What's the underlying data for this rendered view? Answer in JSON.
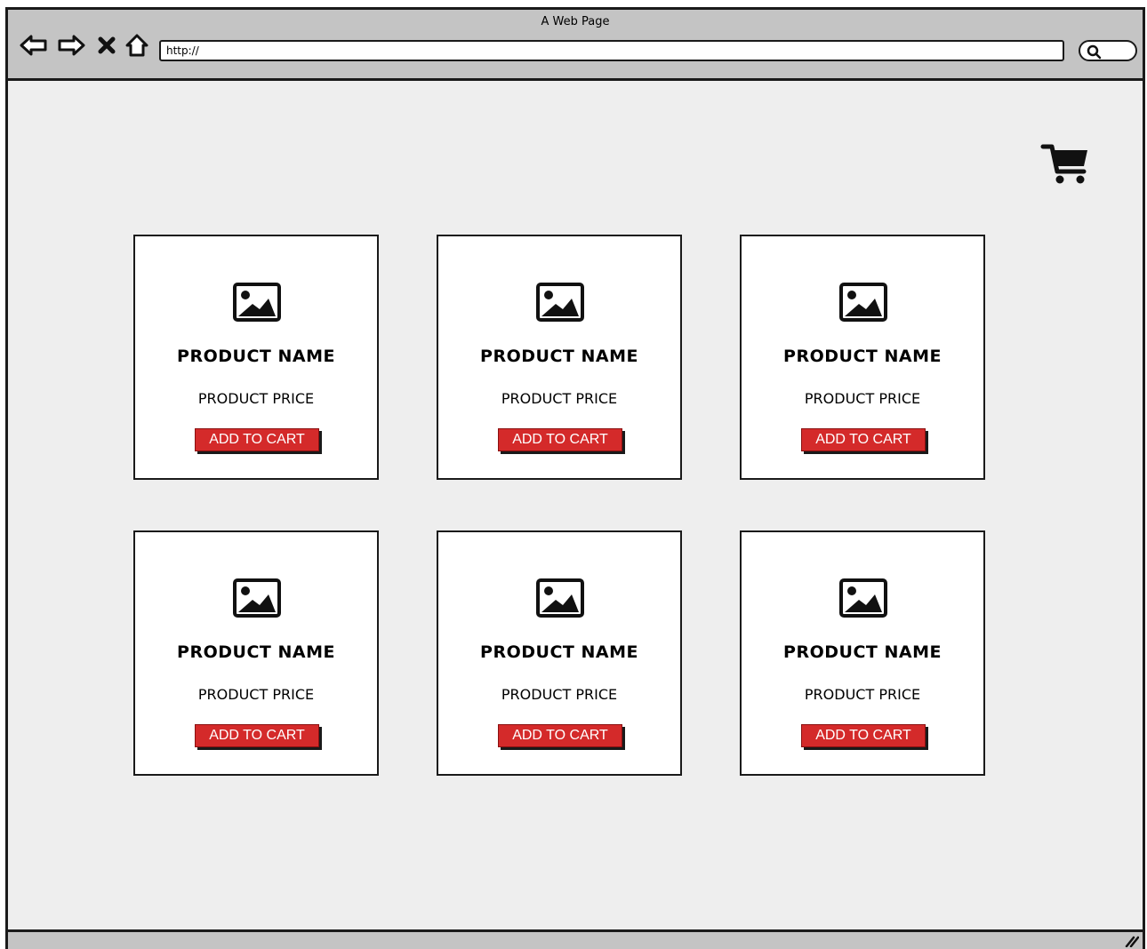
{
  "window": {
    "title": "A Web Page"
  },
  "toolbar": {
    "url": "http://",
    "icons": [
      "back-arrow-icon",
      "forward-arrow-icon",
      "close-icon",
      "home-icon",
      "search-icon"
    ]
  },
  "header": {
    "cart_icon": "shopping-cart-icon"
  },
  "products": [
    {
      "name": "PRODUCT NAME",
      "price": "PRODUCT PRICE",
      "button": "ADD TO CART",
      "image_icon": "image-placeholder-icon"
    },
    {
      "name": "PRODUCT NAME",
      "price": "PRODUCT PRICE",
      "button": "ADD TO CART",
      "image_icon": "image-placeholder-icon"
    },
    {
      "name": "PRODUCT NAME",
      "price": "PRODUCT PRICE",
      "button": "ADD TO CART",
      "image_icon": "image-placeholder-icon"
    },
    {
      "name": "PRODUCT NAME",
      "price": "PRODUCT PRICE",
      "button": "ADD TO CART",
      "image_icon": "image-placeholder-icon"
    },
    {
      "name": "PRODUCT NAME",
      "price": "PRODUCT PRICE",
      "button": "ADD TO CART",
      "image_icon": "image-placeholder-icon"
    },
    {
      "name": "PRODUCT NAME",
      "price": "PRODUCT PRICE",
      "button": "ADD TO CART",
      "image_icon": "image-placeholder-icon"
    }
  ],
  "colors": {
    "button_bg": "#d42a2a",
    "page_bg": "#eeeeee",
    "chrome_bg": "#c4c4c4"
  }
}
